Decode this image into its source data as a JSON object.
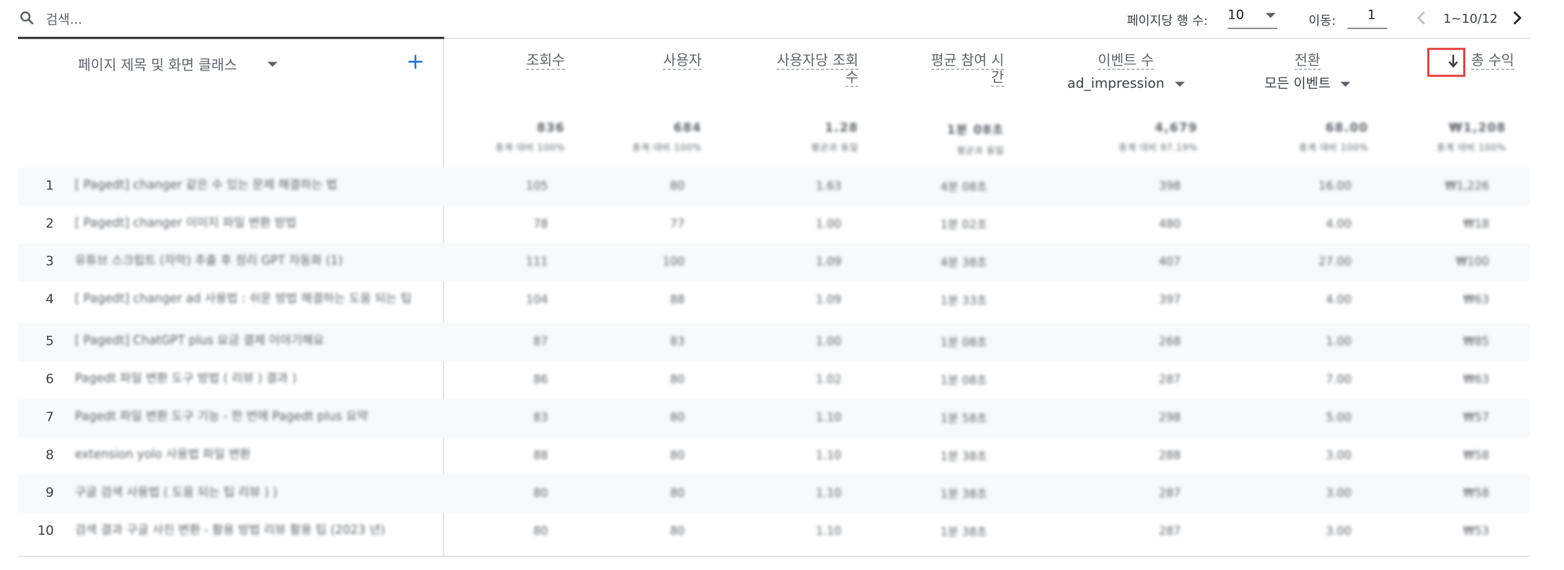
{
  "toolbar": {
    "search_placeholder": "검색...",
    "rows_per_page_label": "페이지당 행 수:",
    "rows_per_page_value": "10",
    "goto_label": "이동:",
    "goto_value": "1",
    "range": "1~10/12"
  },
  "table": {
    "dimension_header": "페이지 제목 및 화면 클래스",
    "add_dimension": "+",
    "metric_headers": [
      {
        "label1": "조회수",
        "label2": ""
      },
      {
        "label1": "사용자",
        "label2": ""
      },
      {
        "label1": "사용자당 조회",
        "label2": "수"
      },
      {
        "label1": "평균 참여 시",
        "label2": "간"
      },
      {
        "label1": "이벤트 수",
        "sub": "ad_impression"
      },
      {
        "label1": "전환",
        "sub": "모든 이벤트"
      },
      {
        "label1": "총 수익",
        "sorted": "descending"
      }
    ],
    "totals": [
      {
        "value": "836",
        "sub": "총계 대비 100%"
      },
      {
        "value": "684",
        "sub": "총계 대비 100%"
      },
      {
        "value": "1.28",
        "sub": "평균과 동일"
      },
      {
        "value": "1분 08초",
        "sub": "평균과 동일"
      },
      {
        "value": "4,679",
        "sub": "총계 대비 97.19%"
      },
      {
        "value": "68.00",
        "sub": "총계 대비 100%"
      },
      {
        "value": "₩1,208",
        "sub": "총계 대비 100%"
      }
    ],
    "rows": [
      {
        "num": "1",
        "title": "[ Pagedt] changer 같은 수 있는 문제 해결하는 법",
        "cells": [
          "105",
          "80",
          "1.63",
          "4분 08초",
          "398",
          "16.00",
          "₩1,226"
        ]
      },
      {
        "num": "2",
        "title": "[ Pagedt] changer 이미지 파일 변환 방법",
        "cells": [
          "78",
          "77",
          "1.00",
          "1분 02초",
          "480",
          "4.00",
          "₩18"
        ]
      },
      {
        "num": "3",
        "title": "유튜브 스크립트 (자막) 추출 후 정리 GPT 자동화 (1)",
        "cells": [
          "111",
          "100",
          "1.09",
          "4분 38초",
          "407",
          "27.00",
          "₩100"
        ]
      },
      {
        "num": "4",
        "title": "[ Pagedt] changer ad 사용법 : 쉬운 방법 해결하는 도움 되는 팁",
        "cells": [
          "104",
          "88",
          "1.09",
          "1분 33초",
          "397",
          "4.00",
          "₩63"
        ]
      },
      {
        "num": "5",
        "title": "[ Pagedt] ChatGPT plus 요금 결제 이야기해요",
        "cells": [
          "87",
          "83",
          "1.00",
          "1분 08초",
          "268",
          "1.00",
          "₩85"
        ]
      },
      {
        "num": "6",
        "title": "Pagedt 파일 변환 도구 방법 ( 리뷰 ) 결과 )",
        "cells": [
          "86",
          "80",
          "1.02",
          "1분 08초",
          "287",
          "7.00",
          "₩63"
        ]
      },
      {
        "num": "7",
        "title": "Pagedt 파일 변환 도구 기능 - 한 번에 Pagedt plus 요약",
        "cells": [
          "83",
          "80",
          "1.10",
          "1분 58초",
          "298",
          "5.00",
          "₩57"
        ]
      },
      {
        "num": "8",
        "title": "extension yolo 사용법 파일 변환",
        "cells": [
          "88",
          "80",
          "1.10",
          "1분 38초",
          "288",
          "3.00",
          "₩58"
        ]
      },
      {
        "num": "9",
        "title": "구글 검색 사용법 ( 도움 되는 팁 리뷰 ) )",
        "cells": [
          "80",
          "80",
          "1.10",
          "1분 38초",
          "287",
          "3.00",
          "₩58"
        ]
      },
      {
        "num": "10",
        "title": "검색 결과 구글 사진 변환 - 활용 방법 리뷰 활용 팁 (2023 년)",
        "cells": [
          "80",
          "80",
          "1.10",
          "1분 38초",
          "287",
          "3.00",
          "₩53"
        ]
      }
    ]
  },
  "colors": {
    "accent": "#1a73e8",
    "sort_highlight": "#e53935",
    "alt_row": "#f8f9fa"
  }
}
